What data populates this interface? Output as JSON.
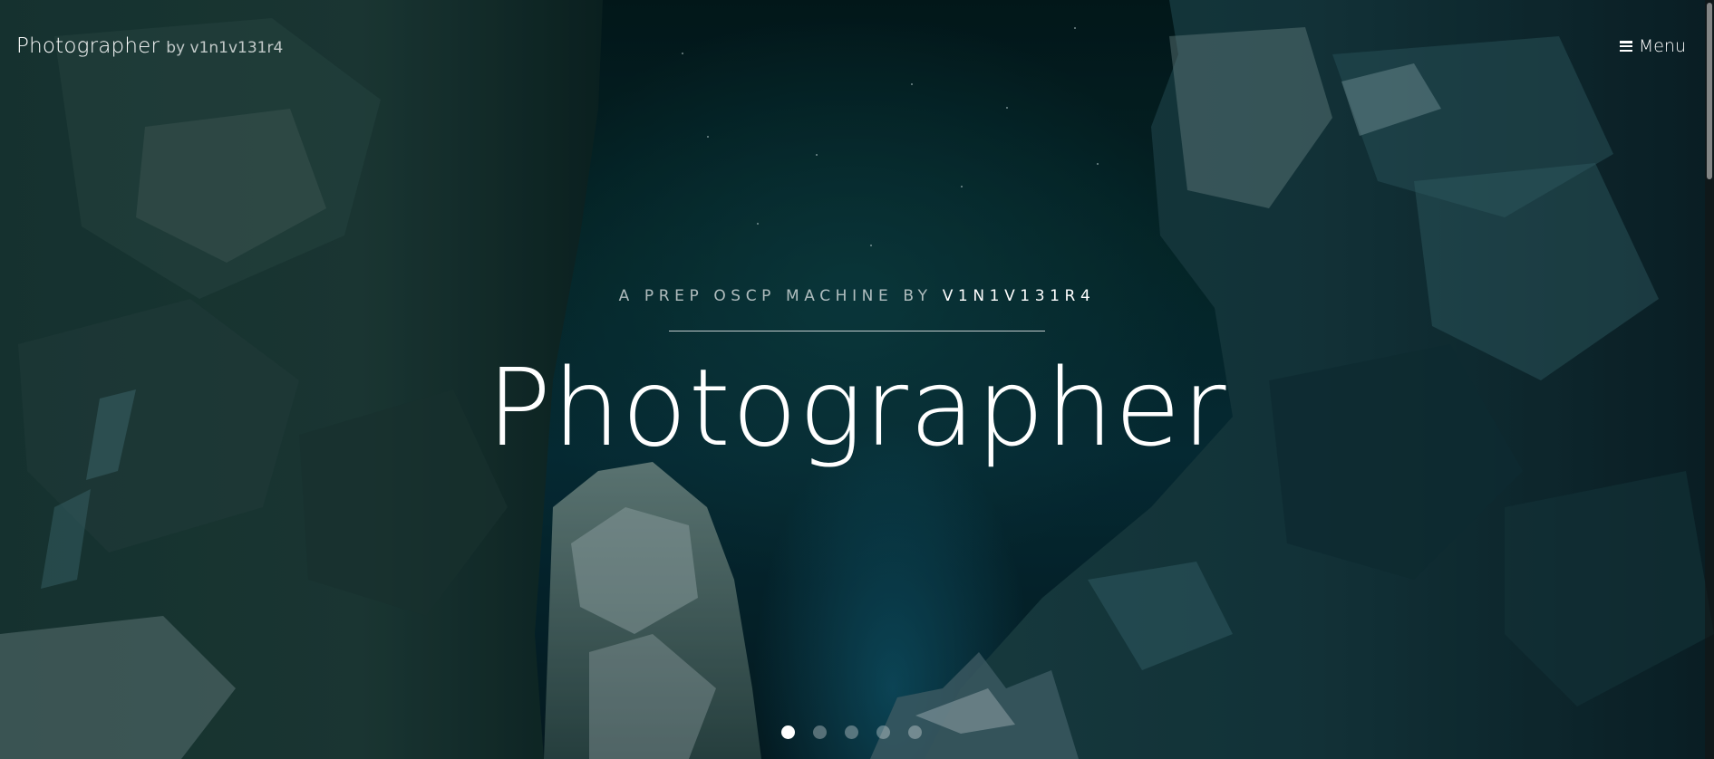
{
  "header": {
    "brand_name": "Photographer",
    "brand_by": "by v1n1v131r4",
    "menu_label": "Menu",
    "menu_icon": "hamburger-icon"
  },
  "hero": {
    "subtitle_prefix": "A PREP OSCP MACHINE BY",
    "subtitle_author": "V1N1V131R4",
    "title": "Photographer"
  },
  "slider": {
    "dot_count": 5,
    "active_index": 0
  },
  "colors": {
    "background": "#062a2c",
    "text": "#ffffff",
    "glow": "#1678a0"
  }
}
